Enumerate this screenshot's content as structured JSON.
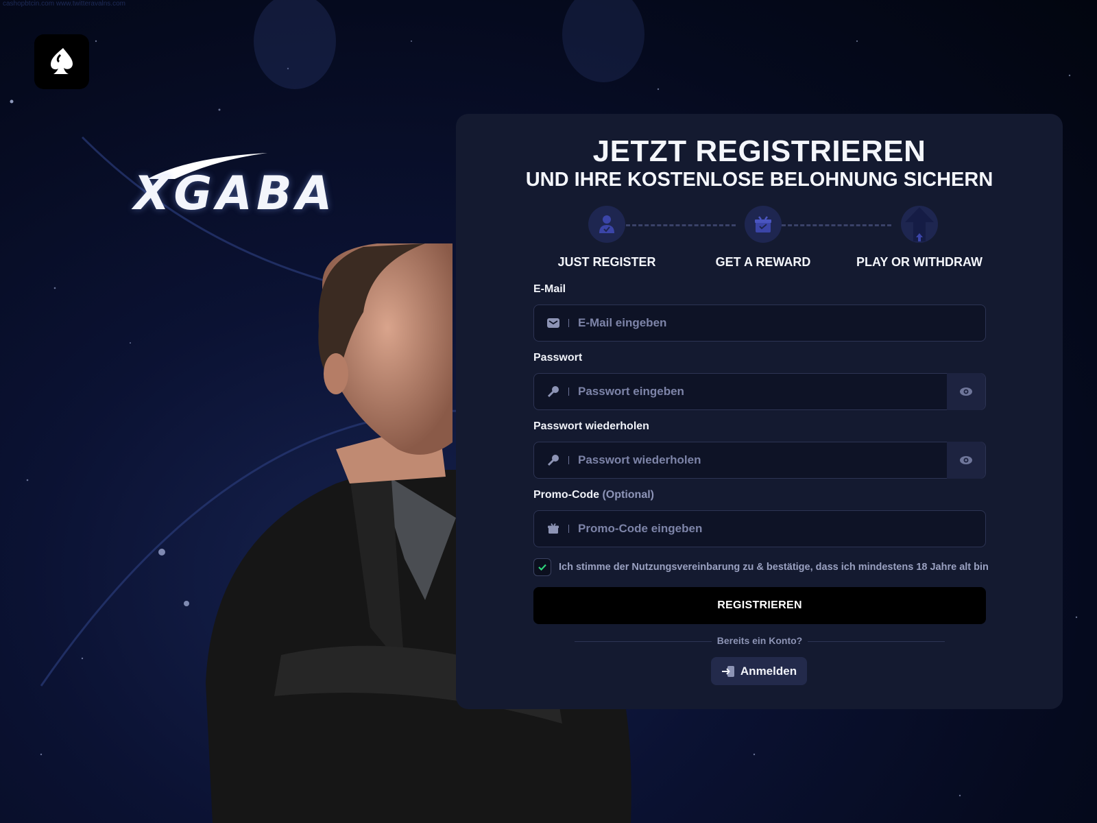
{
  "watermark": "cashopbtcin.com www.twitteravalns.com",
  "brand": {
    "name": "XGABA"
  },
  "form": {
    "title": "JETZT REGISTRIEREN",
    "subtitle": "UND IHRE KOSTENLOSE BELOHNUNG SICHERN",
    "steps": [
      {
        "label": "JUST REGISTER",
        "icon": "user-check-icon"
      },
      {
        "label": "GET A REWARD",
        "icon": "gift-icon"
      },
      {
        "label": "PLAY OR WITHDRAW",
        "icon": "arrow-up-icon"
      }
    ],
    "email": {
      "label": "E-Mail",
      "placeholder": "E-Mail eingeben",
      "value": ""
    },
    "password": {
      "label": "Passwort",
      "placeholder": "Passwort eingeben",
      "value": ""
    },
    "password_repeat": {
      "label": "Passwort wiederholen",
      "placeholder": "Passwort wiederholen",
      "value": ""
    },
    "promo": {
      "label": "Promo-Code",
      "optional": "(Optional)",
      "placeholder": "Promo-Code eingeben",
      "value": ""
    },
    "agree": {
      "checked": true,
      "text": "Ich stimme der Nutzungsvereinbarung zu & bestätige, dass ich mindestens 18 Jahre alt bin"
    },
    "register_button": "REGISTRIEREN",
    "divider_text": "Bereits ein Konto?",
    "login_button": "Anmelden"
  },
  "colors": {
    "panel_bg": "#141a30",
    "input_bg": "#0e1326",
    "accent_check": "#2ed47a",
    "register_bg": "#000000",
    "step_circle": "#1e2650"
  }
}
